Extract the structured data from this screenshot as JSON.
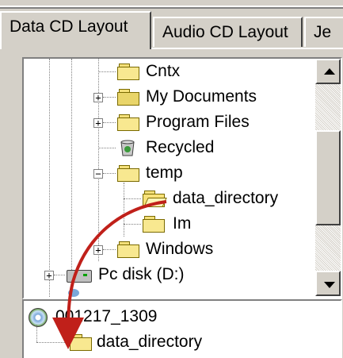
{
  "tabs": [
    {
      "label": "Data CD Layout",
      "active": true
    },
    {
      "label": "Audio CD Layout",
      "active": false
    },
    {
      "label": "Je",
      "active": false
    }
  ],
  "source_tree": {
    "items": [
      {
        "label": "Cntx",
        "icon": "folder-icon"
      },
      {
        "label": "My Documents",
        "icon": "my-documents-icon"
      },
      {
        "label": "Program Files",
        "icon": "folder-icon"
      },
      {
        "label": "Recycled",
        "icon": "recycle-bin-icon"
      },
      {
        "label": "temp",
        "icon": "folder-icon",
        "expanded": true
      },
      {
        "label": "data_directory",
        "icon": "open-folder-icon"
      },
      {
        "label": "Im",
        "icon": "folder-icon"
      },
      {
        "label": "Windows",
        "icon": "folder-icon"
      },
      {
        "label": "Pc disk (D:)",
        "icon": "hard-drive-icon"
      }
    ]
  },
  "cd_tree": {
    "root_label": "001217_1309",
    "child_label": "data_directory"
  },
  "colors": {
    "drag_arrow": "#c0201a",
    "window_face": "#d4d0c8",
    "folder_fill": "#f8e890"
  }
}
